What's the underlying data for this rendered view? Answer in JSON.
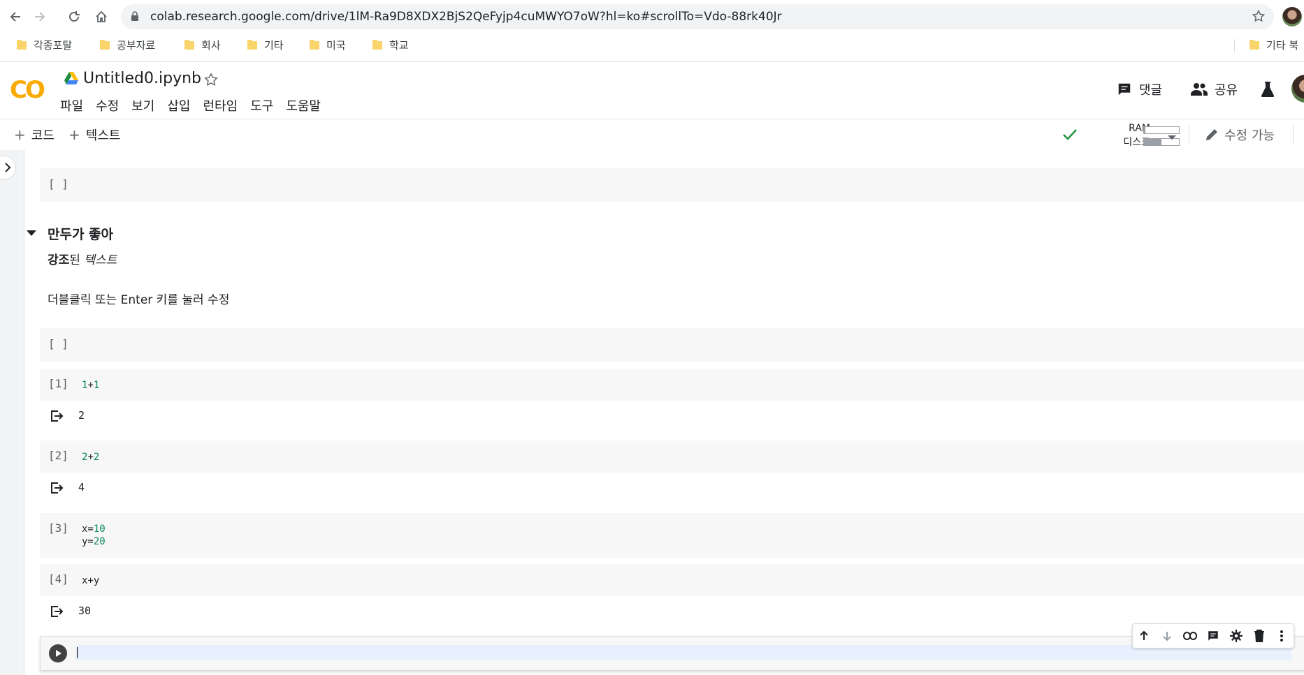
{
  "browser": {
    "url": "colab.research.google.com/drive/1lM-Ra9D8XDX2BjS2QeFyjp4cuMWYO7oW?hl=ko#scrollTo=Vdo-88rk40Jr",
    "bookmarks": [
      "각종포탈",
      "공부자료",
      "회사",
      "기타",
      "미국",
      "학교"
    ],
    "other_bookmarks": "기타 북"
  },
  "colab": {
    "logo": "CO",
    "title": "Untitled0.ipynb",
    "menu": [
      "파일",
      "수정",
      "보기",
      "삽입",
      "런타임",
      "도구",
      "도움말"
    ],
    "comment_label": "댓글",
    "share_label": "공유"
  },
  "toolbar": {
    "add_code": "코드",
    "add_text": "텍스트",
    "ram_label": "RAM",
    "disk_label": "디스크",
    "ram_usage": 0.04,
    "disk_usage": 0.5,
    "edit_mode": "수정 가능"
  },
  "cells": {
    "empty1": {
      "count": "[ ]"
    },
    "markdown": {
      "heading": "만두가 좋아",
      "bold": "강조",
      "after_bold": "된 ",
      "italic": "텍스트",
      "hint": "더블클릭 또는 Enter 키를 눌러 수정"
    },
    "empty2": {
      "count": "[ ]"
    },
    "c1": {
      "count": "[1]",
      "a": "1",
      "op": "+",
      "b": "1",
      "output": "2"
    },
    "c2": {
      "count": "[2]",
      "a": "2",
      "op": "+",
      "b": "2",
      "output": "4"
    },
    "c3": {
      "count": "[3]",
      "line1_var": "x=",
      "line1_val": "10",
      "line2_var": "y=",
      "line2_val": "20"
    },
    "c4": {
      "count": "[4]",
      "source": "x+y",
      "output": "30"
    }
  },
  "colors": {
    "accent_orange": "#f9ab00",
    "check_green": "#1e8e3e",
    "number_green": "#098658"
  }
}
